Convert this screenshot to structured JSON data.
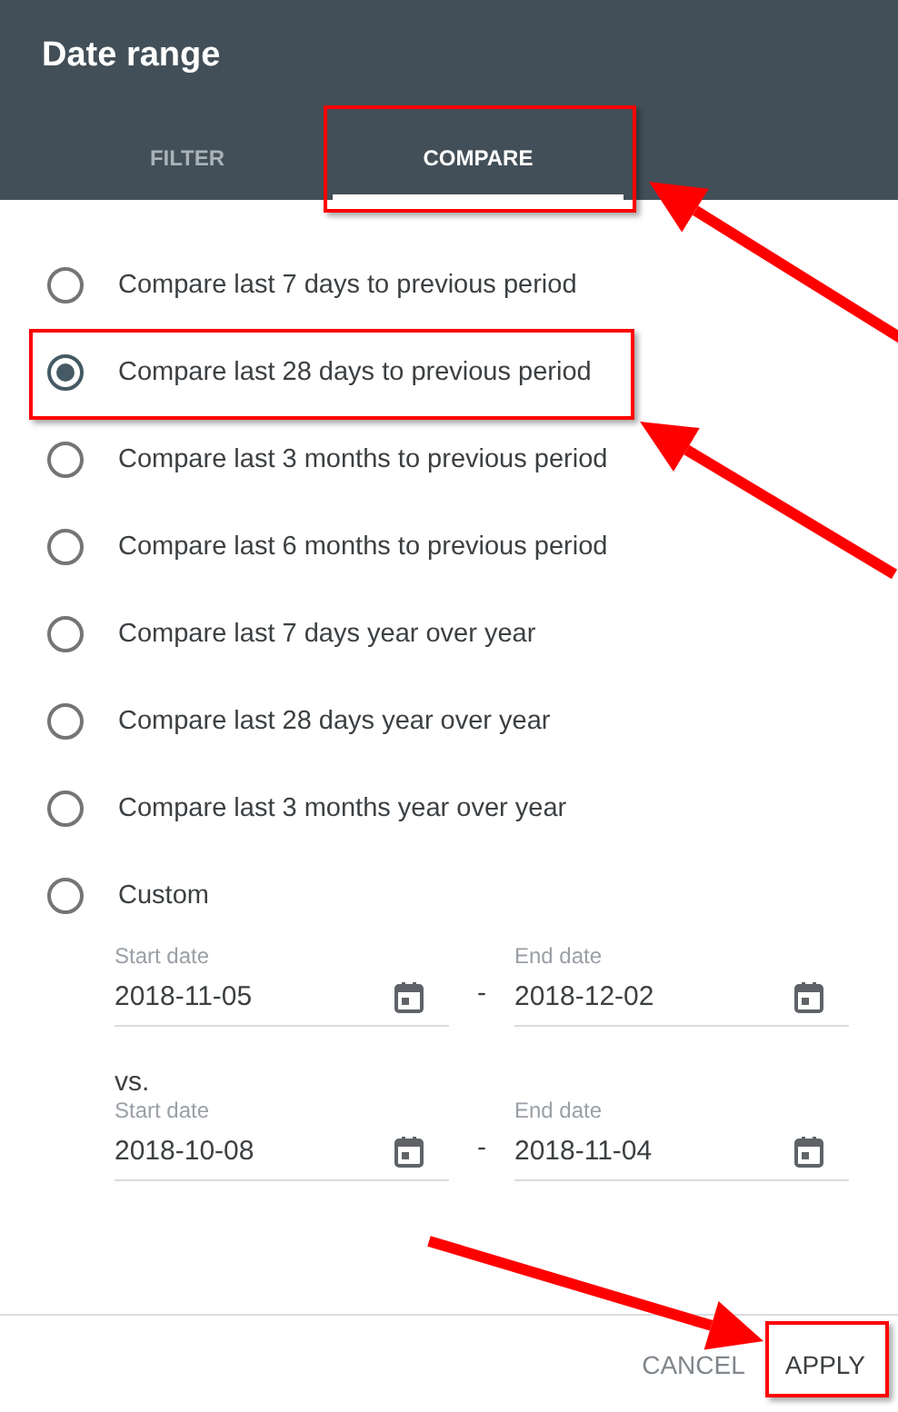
{
  "dialog": {
    "title": "Date range"
  },
  "tabs": [
    {
      "label": "FILTER",
      "selected": false
    },
    {
      "label": "COMPARE",
      "selected": true
    }
  ],
  "options": [
    {
      "label": "Compare last 7 days to previous period",
      "selected": false
    },
    {
      "label": "Compare last 28 days to previous period",
      "selected": true
    },
    {
      "label": "Compare last 3 months to previous period",
      "selected": false
    },
    {
      "label": "Compare last 6 months to previous period",
      "selected": false
    },
    {
      "label": "Compare last 7 days year over year",
      "selected": false
    },
    {
      "label": "Compare last 28 days year over year",
      "selected": false
    },
    {
      "label": "Compare last 3 months year over year",
      "selected": false
    },
    {
      "label": "Custom",
      "selected": false
    }
  ],
  "current_range": {
    "start_label": "Start date",
    "start_value": "2018-11-05",
    "separator": "-",
    "end_label": "End date",
    "end_value": "2018-12-02"
  },
  "comparison_label": "vs.",
  "previous_range": {
    "start_label": "Start date",
    "start_value": "2018-10-08",
    "separator": "-",
    "end_label": "End date",
    "end_value": "2018-11-04"
  },
  "buttons": [
    {
      "label": "CANCEL",
      "kind": "secondary"
    },
    {
      "label": "APPLY",
      "kind": "primary"
    }
  ]
}
